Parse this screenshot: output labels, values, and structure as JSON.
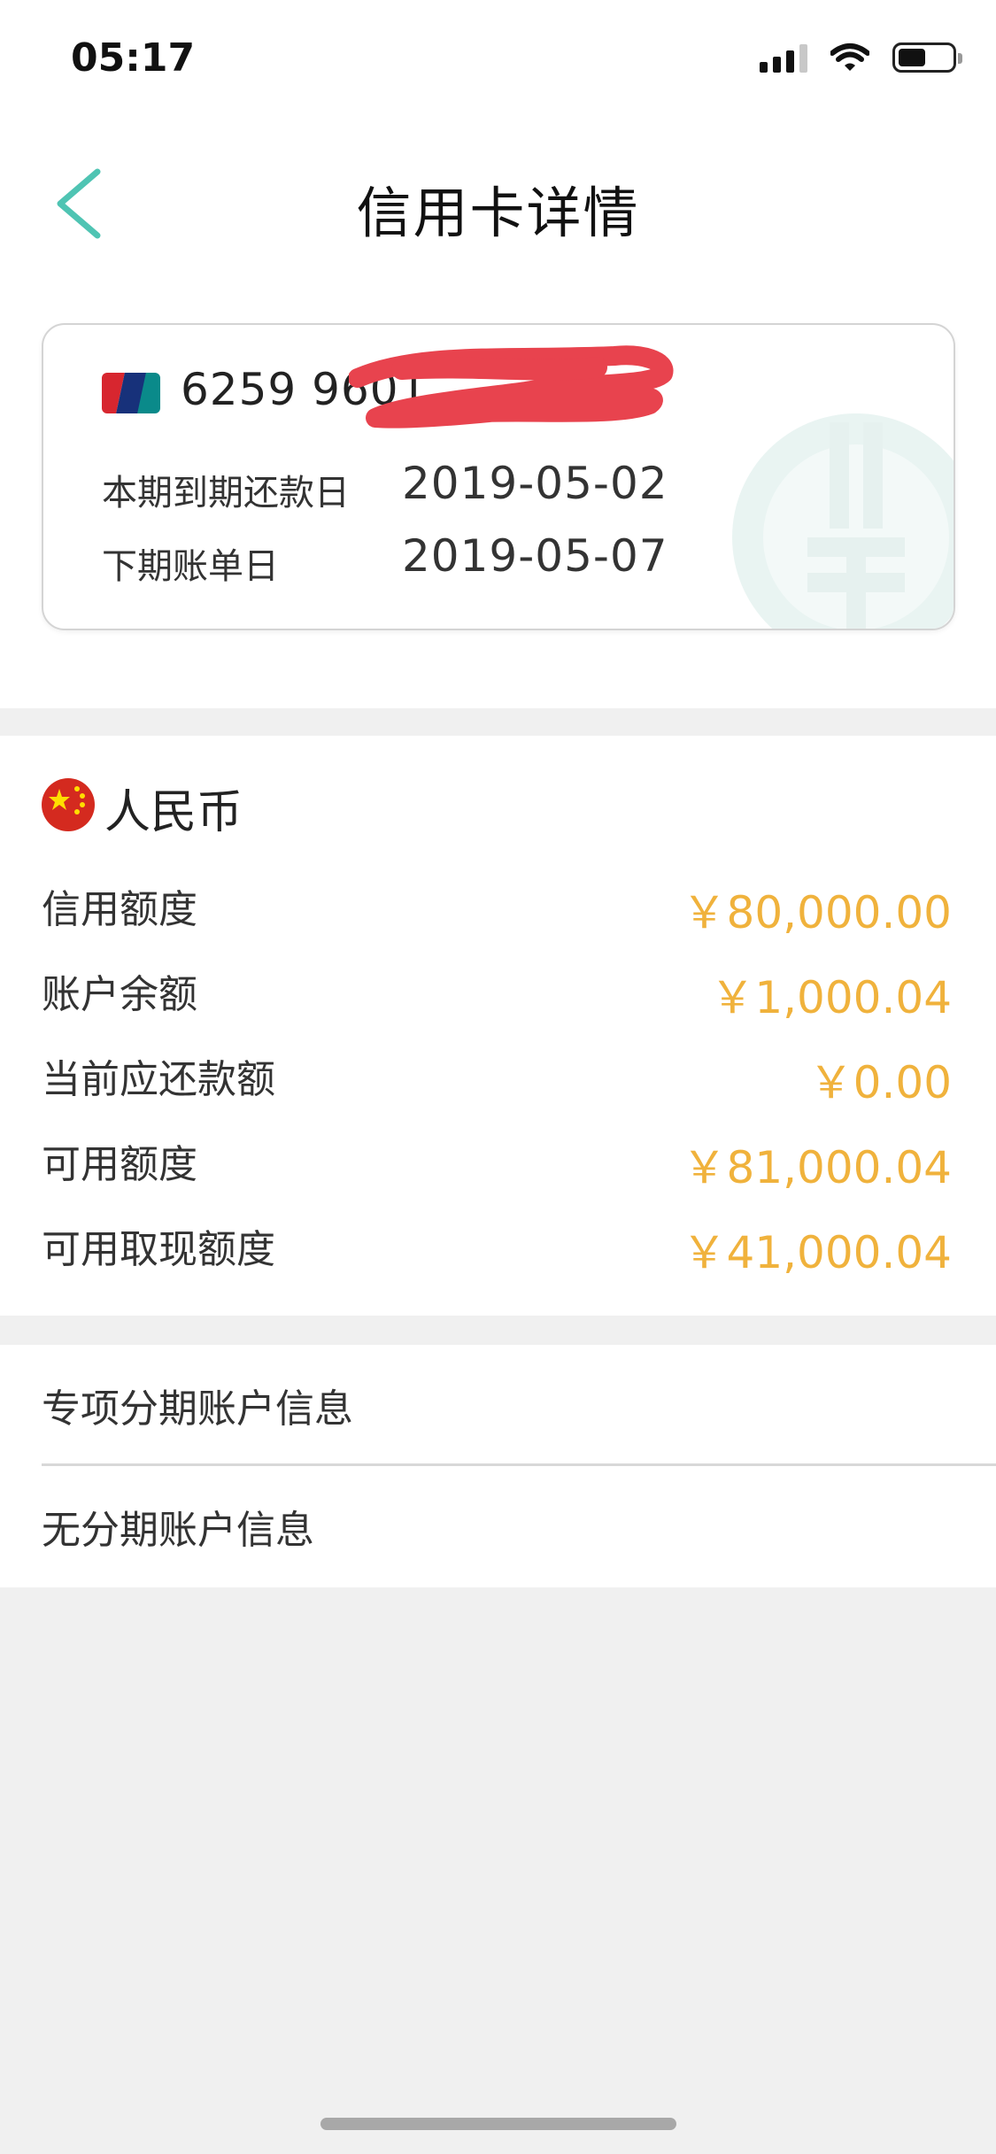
{
  "status_bar": {
    "time": "05:17"
  },
  "nav": {
    "title": "信用卡详情"
  },
  "card": {
    "number": "6259 9601",
    "rows": [
      {
        "label": "本期到期还款日",
        "value": "2019-05-02"
      },
      {
        "label": "下期账单日",
        "value": "2019-05-07"
      }
    ]
  },
  "currency": {
    "title": "人民币",
    "rows": [
      {
        "label": "信用额度",
        "value": "￥80,000.00"
      },
      {
        "label": "账户余额",
        "value": "￥1,000.04"
      },
      {
        "label": "当前应还款额",
        "value": "￥0.00"
      },
      {
        "label": "可用额度",
        "value": "￥81,000.04"
      },
      {
        "label": "可用取现额度",
        "value": "￥41,000.04"
      }
    ]
  },
  "list": {
    "items": [
      {
        "label": "专项分期账户信息"
      },
      {
        "label": "无分期账户信息"
      }
    ]
  },
  "colors": {
    "accent": "#4fc4b3",
    "amount": "#f0b23c",
    "redaction": "#e8434e"
  },
  "icons": [
    "back-arrow-icon",
    "signal-icon",
    "wifi-icon",
    "battery-icon",
    "unionpay-icon",
    "china-flag-icon",
    "bank-logo-watermark-icon"
  ]
}
